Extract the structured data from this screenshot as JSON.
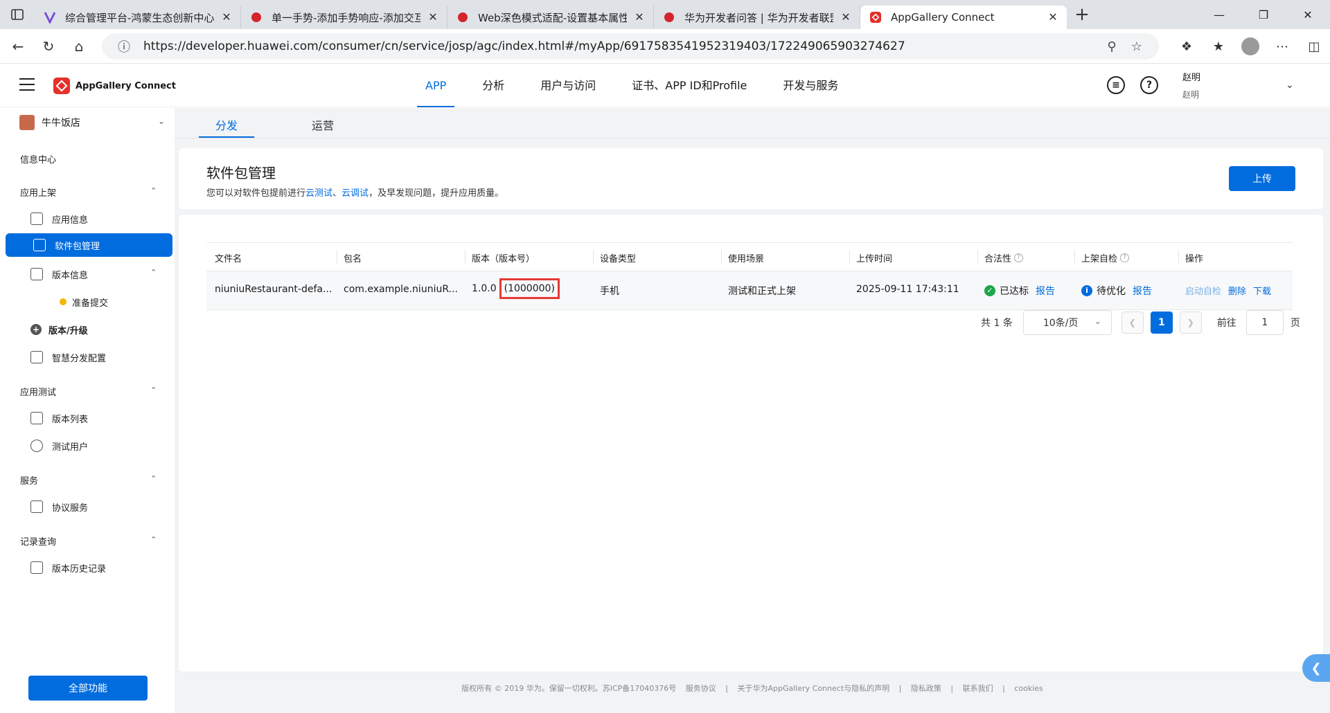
{
  "browser": {
    "tabs": [
      {
        "title": "综合管理平台-鸿蒙生态创新中心",
        "close": "✕"
      },
      {
        "title": "单一手势-添加手势响应-添加交互",
        "close": "✕"
      },
      {
        "title": "Web深色模式适配-设置基本属性和",
        "close": "✕"
      },
      {
        "title": "华为开发者问答 | 华为开发者联盟",
        "close": "✕"
      },
      {
        "title": "AppGallery Connect",
        "close": "✕"
      }
    ],
    "url": "https://developer.huawei.com/consumer/cn/service/josp/agc/index.html#/myApp/6917583541952319403/172249065903274627"
  },
  "header": {
    "brand": "AppGallery Connect",
    "nav": [
      "APP",
      "分析",
      "用户与访问",
      "证书、APP ID和Profile",
      "开发与服务"
    ],
    "user_name": "赵明",
    "user_sub": "赵明"
  },
  "sidebar": {
    "store": "牛牛饭店",
    "info_center": "信息中心",
    "sec_publish": "应用上架",
    "app_info": "应用信息",
    "pkg_mgmt": "软件包管理",
    "version_info": "版本信息",
    "prep_submit": "准备提交",
    "version_upgrade": "版本/升级",
    "smart_dist": "智慧分发配置",
    "sec_test": "应用测试",
    "version_list": "版本列表",
    "test_users": "测试用户",
    "sec_service": "服务",
    "agreement": "协议服务",
    "sec_records": "记录查询",
    "version_history": "版本历史记录",
    "all_functions": "全部功能"
  },
  "subtabs": [
    "分发",
    "运营"
  ],
  "package": {
    "title": "软件包管理",
    "desc_pre": "您可以对软件包提前进行",
    "link1": "云测试",
    "sep": "、",
    "link2": "云调试",
    "desc_post": "，及早发现问题，提升应用质量。",
    "upload": "上传"
  },
  "table": {
    "headers": [
      "文件名",
      "包名",
      "版本（版本号）",
      "设备类型",
      "使用场景",
      "上传时间",
      "合法性",
      "上架自检",
      "操作"
    ],
    "row": {
      "file": "niuniuRestaurant-defa...",
      "pkg": "com.example.niuniuR...",
      "version": "1.0.0",
      "version_code": "(1000000)",
      "device": "手机",
      "scene": "测试和正式上架",
      "time": "2025-09-11 17:43:11",
      "legal": "已达标",
      "legal_link": "报告",
      "check": "待优化",
      "check_link": "报告",
      "op1": "启动自检",
      "op2": "删除",
      "op3": "下载"
    }
  },
  "pager": {
    "total": "共 1 条",
    "size": "10条/页",
    "page": "1",
    "goto": "前往",
    "goto_val": "1",
    "unit": "页"
  },
  "footer": [
    "版权所有 © 2019 华为。保留一切权利。苏ICP备17040376号",
    "服务协议",
    "|",
    "关于华为AppGallery Connect与隐私的声明",
    "|",
    "隐私政策",
    "|",
    "联系我们",
    "|",
    "cookies"
  ]
}
